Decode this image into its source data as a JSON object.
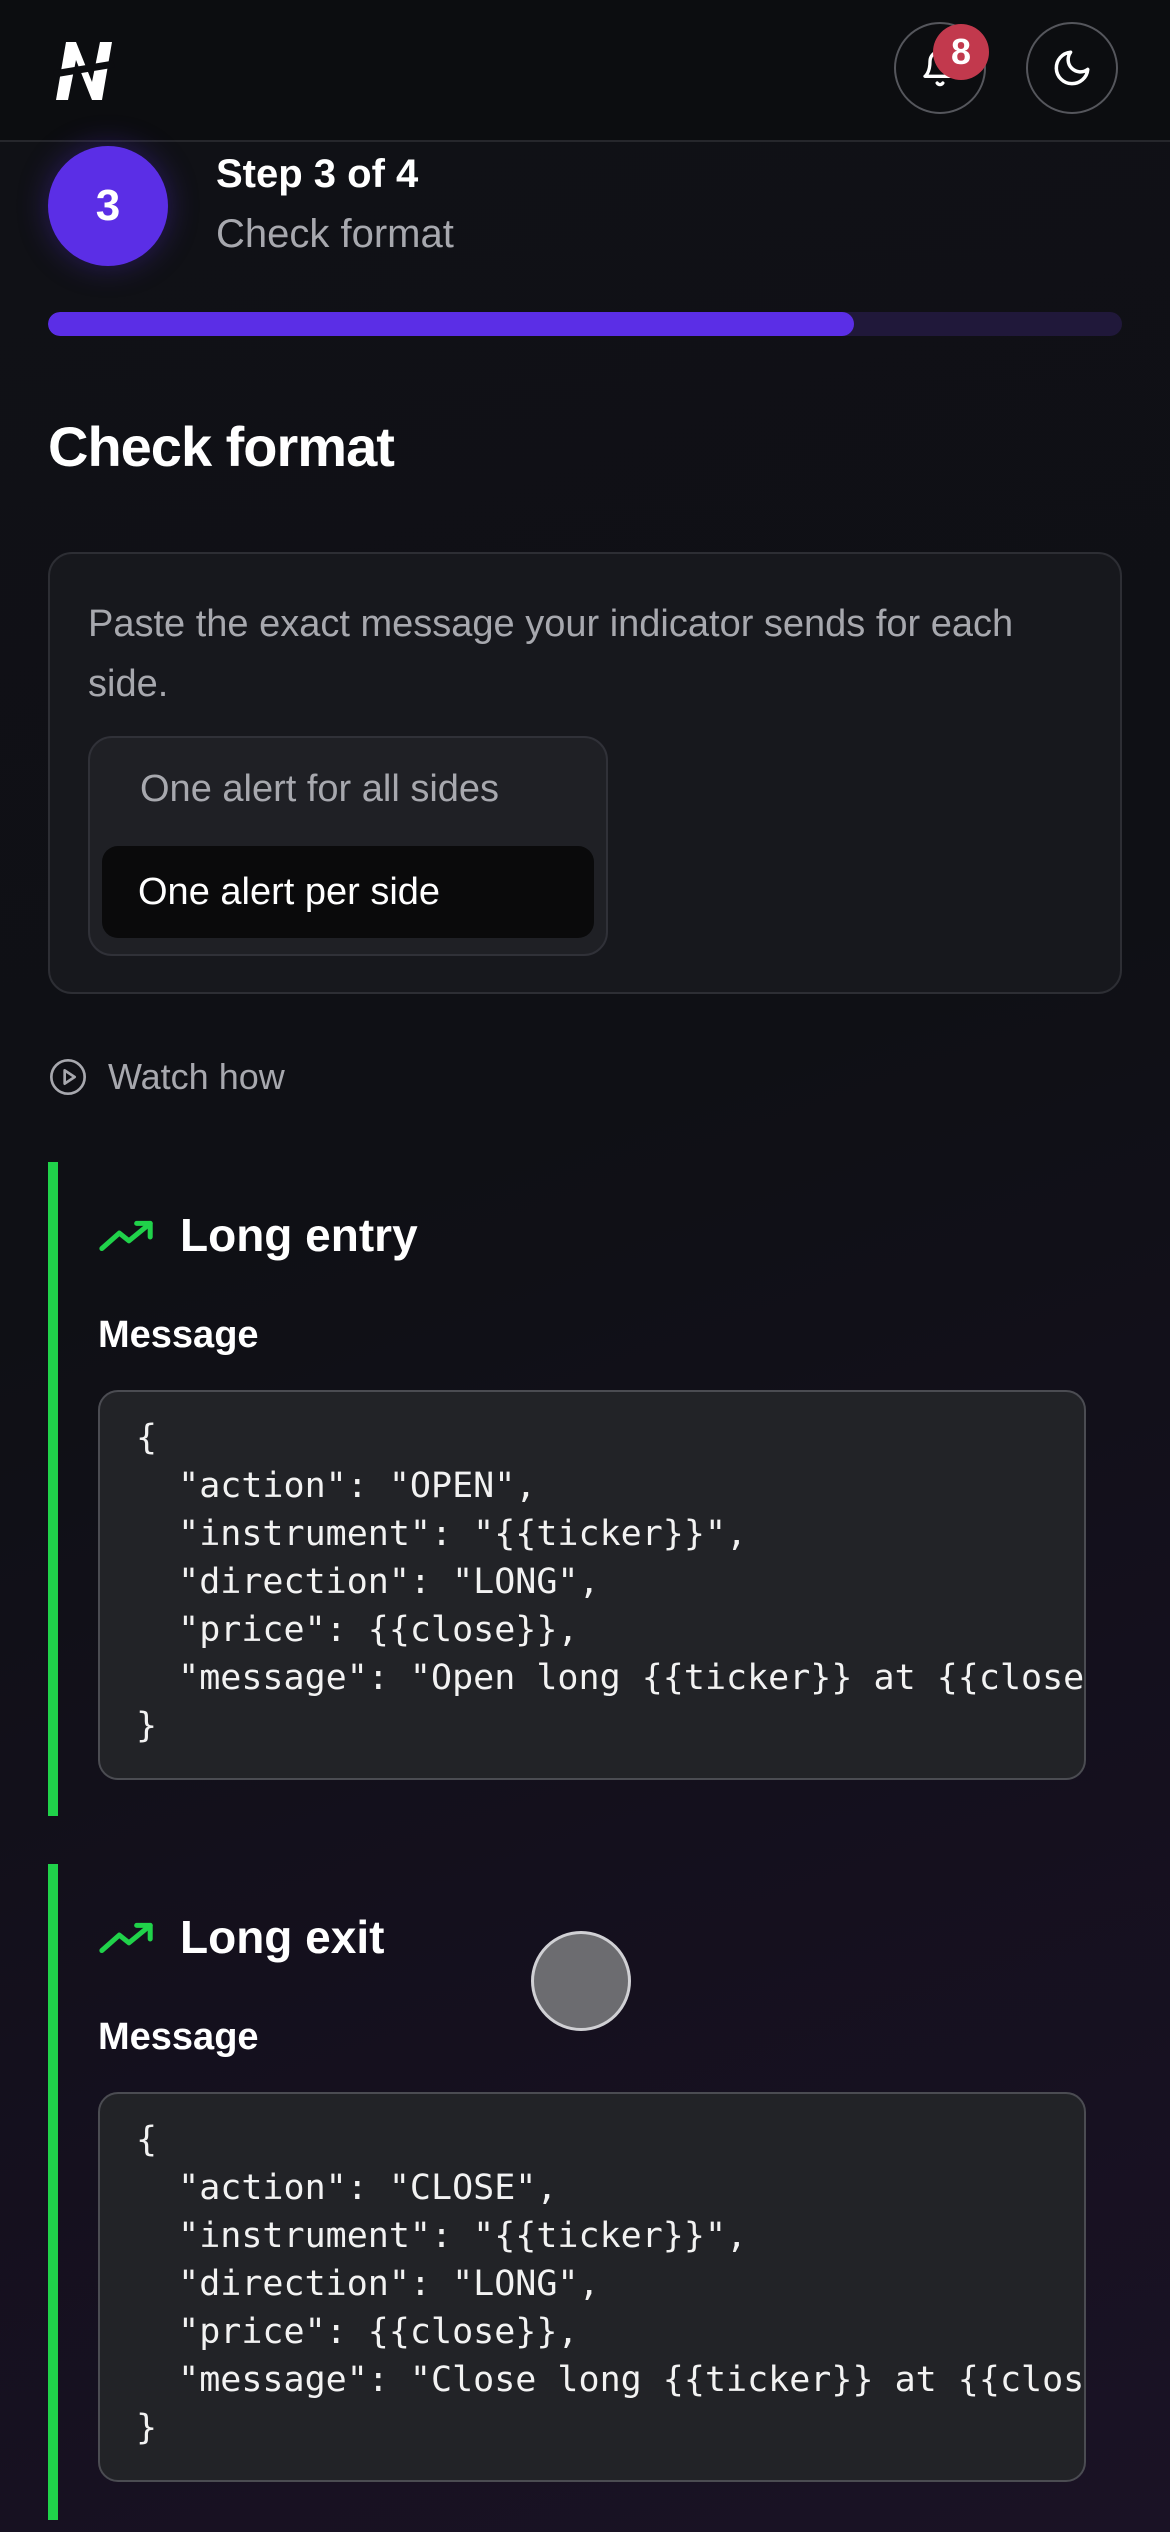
{
  "header": {
    "logo_icon": "brand-logo-icon",
    "notification_count": "8",
    "bell_icon": "bell-icon",
    "theme_icon": "moon-icon"
  },
  "stepper": {
    "number": "3",
    "title": "Step 3 of 4",
    "subtitle": "Check format",
    "progress_fraction": 0.75,
    "accent_color": "#5b2ee6"
  },
  "page": {
    "title": "Check format"
  },
  "format_card": {
    "description": "Paste the exact message your indicator sends for each side.",
    "options": [
      "One alert for all sides",
      "One alert per side"
    ],
    "selected_index": 1
  },
  "watch_how": {
    "label": "Watch how",
    "icon": "play-circle-icon"
  },
  "sections": [
    {
      "title": "Long entry",
      "icon": "trending-up-icon",
      "message_label": "Message",
      "message": "{\n  \"action\": \"OPEN\",\n  \"instrument\": \"{{ticker}}\",\n  \"direction\": \"LONG\",\n  \"price\": {{close}},\n  \"message\": \"Open long {{ticker}} at {{close}}\"\n}"
    },
    {
      "title": "Long exit",
      "icon": "trending-up-icon",
      "message_label": "Message",
      "message": "{\n  \"action\": \"CLOSE\",\n  \"instrument\": \"{{ticker}}\",\n  \"direction\": \"LONG\",\n  \"price\": {{close}},\n  \"message\": \"Close long {{ticker}} at {{close}}\"\n}"
    }
  ],
  "colors": {
    "section_accent": "#20d24a",
    "badge": "#c2394d"
  }
}
